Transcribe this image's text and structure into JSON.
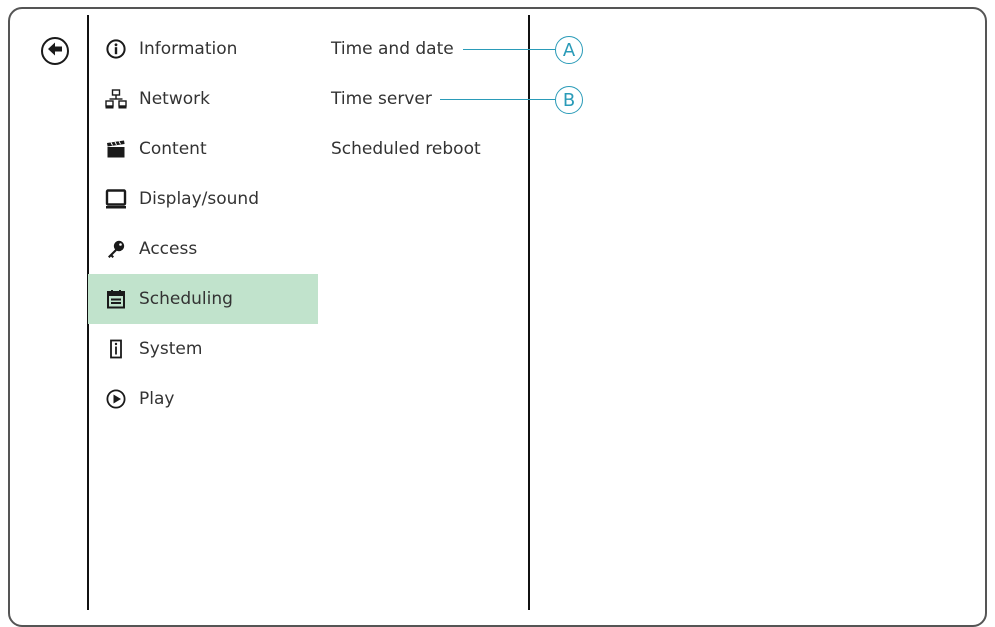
{
  "nav": {
    "back_icon": "arrow-left-circle-icon",
    "items": [
      {
        "id": "information",
        "label": "Information",
        "icon": "info-icon",
        "active": false
      },
      {
        "id": "network",
        "label": "Network",
        "icon": "network-icon",
        "active": false
      },
      {
        "id": "content",
        "label": "Content",
        "icon": "clapperboard-icon",
        "active": false
      },
      {
        "id": "display-sound",
        "label": "Display/sound",
        "icon": "monitor-icon",
        "active": false
      },
      {
        "id": "access",
        "label": "Access",
        "icon": "key-icon",
        "active": false
      },
      {
        "id": "scheduling",
        "label": "Scheduling",
        "icon": "calendar-icon",
        "active": true
      },
      {
        "id": "system",
        "label": "System",
        "icon": "system-icon",
        "active": false
      },
      {
        "id": "play",
        "label": "Play",
        "icon": "play-icon",
        "active": false
      }
    ]
  },
  "submenu": {
    "items": [
      {
        "label": "Time and date"
      },
      {
        "label": "Time server"
      },
      {
        "label": "Scheduled reboot"
      }
    ]
  },
  "callouts": [
    {
      "letter": "A"
    },
    {
      "letter": "B"
    }
  ],
  "colors": {
    "active_bg": "#c1e3cc",
    "callout": "#2a9bb8",
    "text": "#333333"
  }
}
